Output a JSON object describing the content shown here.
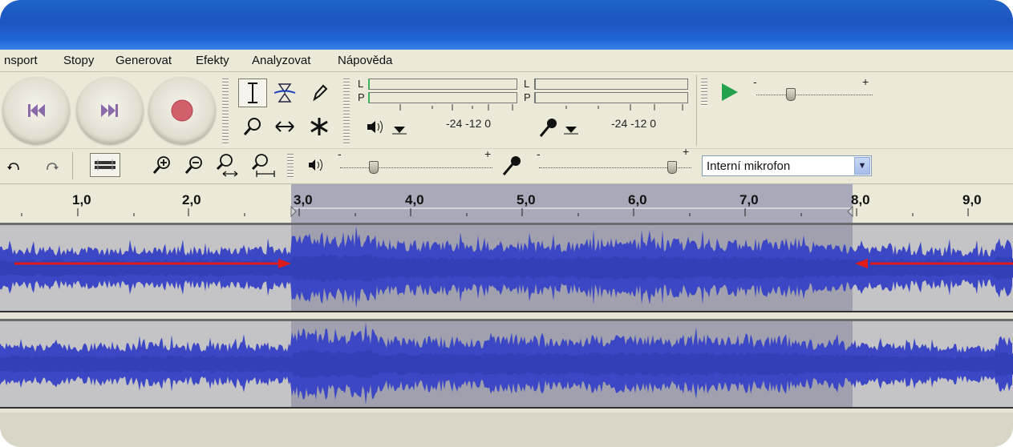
{
  "menu": [
    "nsport",
    "Stopy",
    "Generovat",
    "Efekty",
    "Analyzovat",
    "Nápověda"
  ],
  "meters": {
    "left_channel": "L",
    "right_channel": "P",
    "scale": "-24  -12  0",
    "record_scale": "-24  -12  0"
  },
  "mixer": {
    "minus": "-",
    "plus": "+",
    "input_device": "Interní mikrofon"
  },
  "ruler": {
    "labels": [
      "1,0",
      "2,0",
      "3,0",
      "4,0",
      "5,0",
      "6,0",
      "7,0",
      "8,0",
      "9,0"
    ],
    "selection_start": 3.0,
    "selection_end": 8.0
  },
  "colors": {
    "titlebar": "#1c55c0",
    "waveform": "#3b47c4",
    "waveform_selected": "#3240b8",
    "selection": "#a0a0ae",
    "arrows": "#e01b1b",
    "play": "#22a24c",
    "record": "#d2606b"
  },
  "icons": {
    "skip_start": "skip-start-icon",
    "skip_end": "skip-end-icon",
    "record": "record-icon",
    "play": "play-icon",
    "undo": "undo-icon",
    "redo": "redo-icon",
    "zoom_in": "zoom-in-icon",
    "zoom_out": "zoom-out-icon"
  }
}
